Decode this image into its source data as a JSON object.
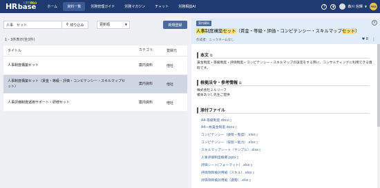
{
  "header": {
    "logo_hr": "HR",
    "logo_base": "base",
    "logo_sub": "人事労務",
    "logo_pro": "PRO",
    "nav": [
      "ホーム",
      "資料一覧",
      "労務管理ガイド",
      "労務マガジン",
      "チャット",
      "労務相談AI"
    ],
    "user_name": "森川 信輝",
    "pro_badge": "PRO"
  },
  "search": {
    "value": "人事　セット",
    "filter_label": "絞り込み",
    "sort_label": "更新順",
    "new_label": "新規登録"
  },
  "result_count": "1 - 3件表示(全3件)",
  "table": {
    "headers": [
      "タイトル",
      "カテゴリ",
      "登録元"
    ],
    "rows": [
      {
        "title": "人事制度構築セット",
        "category": "案内資料",
        "source": "他社"
      },
      {
        "title": "人事制度構築セット（賃金・等級・評価・コンピテンシー・スキルマップセット）",
        "category": "案内資料",
        "source": "他社"
      },
      {
        "title": "人事評価制度運用サポート・研修セット",
        "category": "案内資料",
        "source": "他社"
      }
    ]
  },
  "detail": {
    "badge": "案内資料",
    "title_parts": [
      "人事",
      "制度構築",
      "セット",
      "（賃金・等級・評価・コンピテンシー・スキルマップ",
      "セット",
      "）"
    ],
    "author": "作成者：ニックネームなし",
    "likes": "♥ 8",
    "sections": {
      "main": "本文",
      "law": "根拠法令・参考情報",
      "files": "添付ファイル"
    },
    "main_text": "賃金制度・等級制度・評価制度・コンピテンシー・スキルマップの設定をする際に、コンサルティングに利用できる資料です。",
    "law_text_1": "株式会社ミルリーフ",
    "law_text_2": "榎本あつし先生ご提供",
    "files": [
      "A4-等級制度.docx",
      "A4一枚賃金制度.docx",
      "コンピテンシー（姿勢・態度）.xlsx",
      "コンピテンシー（役割・能力）.xlsx",
      "スキルマップシート（サンプル）.xlsx",
      "人事評価制度概要.pptx",
      "評価シート(フォーマット）.xlsx",
      "評価項目検討用紙（スキル）.xlsx",
      "評価項目検討用紙（姿勢）.xlsx"
    ]
  },
  "colors": {
    "header_bg": "#1e3a6e",
    "accent": "#4d6a9c",
    "highlight": "#f5e27a",
    "selected_row": "#cfd6e3",
    "link": "#3a5f9a"
  }
}
